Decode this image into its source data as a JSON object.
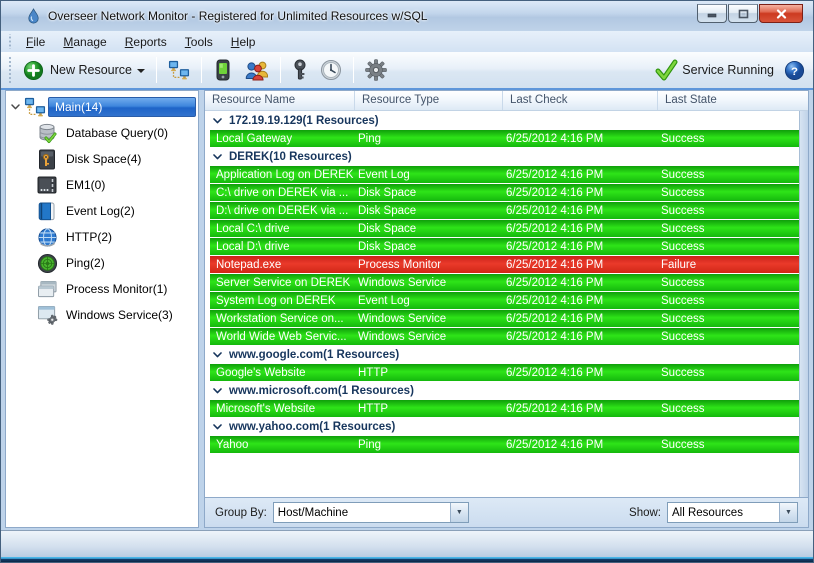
{
  "window": {
    "title": "Overseer Network Monitor - Registered for Unlimited Resources w/SQL"
  },
  "menu": {
    "items": [
      {
        "label": "File"
      },
      {
        "label": "Manage"
      },
      {
        "label": "Reports"
      },
      {
        "label": "Tools"
      },
      {
        "label": "Help"
      }
    ]
  },
  "toolbar": {
    "new_resource_label": "New Resource",
    "icons": [
      "network-icon",
      "phone-icon",
      "users-icon",
      "key-icon",
      "clock-icon",
      "gear-icon"
    ],
    "service_status_label": "Service Running"
  },
  "sidebar": {
    "items": [
      {
        "label": "Main(14)",
        "icon": "network-icon",
        "selected": true,
        "expanded": true
      },
      {
        "label": "Database Query(0)",
        "icon": "database-icon"
      },
      {
        "label": "Disk Space(4)",
        "icon": "disk-icon"
      },
      {
        "label": "EM1(0)",
        "icon": "em1-icon"
      },
      {
        "label": "Event Log(2)",
        "icon": "eventlog-icon"
      },
      {
        "label": "HTTP(2)",
        "icon": "http-icon"
      },
      {
        "label": "Ping(2)",
        "icon": "ping-icon"
      },
      {
        "label": "Process Monitor(1)",
        "icon": "process-icon"
      },
      {
        "label": "Windows Service(3)",
        "icon": "service-icon"
      }
    ]
  },
  "table": {
    "columns": [
      "Resource Name",
      "Resource Type",
      "Last Check",
      "Last State"
    ],
    "groups": [
      {
        "label": "172.19.19.129(1 Resources)",
        "rows": [
          {
            "name": "Local Gateway",
            "type": "Ping",
            "check": "6/25/2012 4:16 PM",
            "state": "Success",
            "status": "success"
          }
        ]
      },
      {
        "label": "DEREK(10 Resources)",
        "rows": [
          {
            "name": "Application Log on DEREK",
            "type": "Event Log",
            "check": "6/25/2012 4:16 PM",
            "state": "Success",
            "status": "success"
          },
          {
            "name": "C:\\ drive on DEREK via ...",
            "type": "Disk Space",
            "check": "6/25/2012 4:16 PM",
            "state": "Success",
            "status": "success"
          },
          {
            "name": "D:\\ drive on DEREK via ...",
            "type": "Disk Space",
            "check": "6/25/2012 4:16 PM",
            "state": "Success",
            "status": "success"
          },
          {
            "name": "Local C:\\ drive",
            "type": "Disk Space",
            "check": "6/25/2012 4:16 PM",
            "state": "Success",
            "status": "success"
          },
          {
            "name": "Local D:\\ drive",
            "type": "Disk Space",
            "check": "6/25/2012 4:16 PM",
            "state": "Success",
            "status": "success"
          },
          {
            "name": "Notepad.exe",
            "type": "Process Monitor",
            "check": "6/25/2012 4:16 PM",
            "state": "Failure",
            "status": "failure"
          },
          {
            "name": "Server Service on DEREK",
            "type": "Windows Service",
            "check": "6/25/2012 4:16 PM",
            "state": "Success",
            "status": "success"
          },
          {
            "name": "System Log on DEREK",
            "type": "Event Log",
            "check": "6/25/2012 4:16 PM",
            "state": "Success",
            "status": "success"
          },
          {
            "name": "Workstation Service on...",
            "type": "Windows Service",
            "check": "6/25/2012 4:16 PM",
            "state": "Success",
            "status": "success"
          },
          {
            "name": "World Wide Web Servic...",
            "type": "Windows Service",
            "check": "6/25/2012 4:16 PM",
            "state": "Success",
            "status": "success"
          }
        ]
      },
      {
        "label": "www.google.com(1 Resources)",
        "rows": [
          {
            "name": "Google's Website",
            "type": "HTTP",
            "check": "6/25/2012 4:16 PM",
            "state": "Success",
            "status": "success"
          }
        ]
      },
      {
        "label": "www.microsoft.com(1 Resources)",
        "rows": [
          {
            "name": "Microsoft's Website",
            "type": "HTTP",
            "check": "6/25/2012 4:16 PM",
            "state": "Success",
            "status": "success"
          }
        ]
      },
      {
        "label": "www.yahoo.com(1 Resources)",
        "rows": [
          {
            "name": "Yahoo",
            "type": "Ping",
            "check": "6/25/2012 4:16 PM",
            "state": "Success",
            "status": "success"
          }
        ]
      }
    ]
  },
  "footer": {
    "group_by_label": "Group By:",
    "group_by_value": "Host/Machine",
    "show_label": "Show:",
    "show_value": "All Resources"
  },
  "colors": {
    "success_top": "#0f9e0a",
    "success_mid": "#2ee418",
    "success_bottom": "#14b80d",
    "failure_top": "#c9231a",
    "failure_mid": "#ea3a2a",
    "failure_bottom": "#d02616",
    "selection": "#2e6fce",
    "group_text": "#17365d"
  }
}
